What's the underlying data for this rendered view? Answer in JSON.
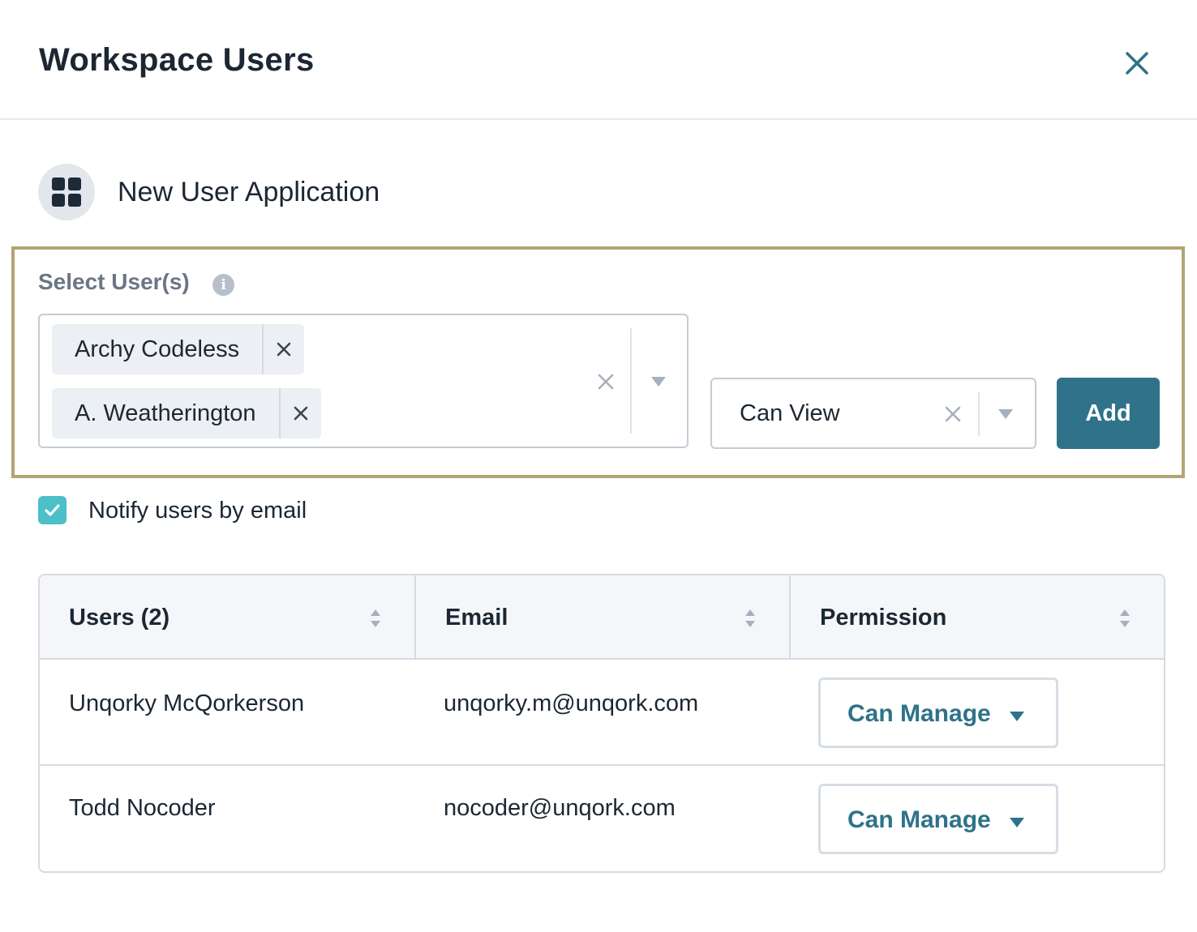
{
  "header": {
    "title": "Workspace Users"
  },
  "application": {
    "name": "New User Application",
    "icon": "grid-icon"
  },
  "select_users": {
    "label": "Select User(s)",
    "selected": [
      {
        "label": "Archy Codeless"
      },
      {
        "label": "A. Weatherington"
      }
    ],
    "permission_value": "Can View",
    "add_label": "Add"
  },
  "notify": {
    "label": "Notify users by email",
    "checked": true
  },
  "table": {
    "columns": [
      {
        "label": "Users (2)"
      },
      {
        "label": "Email"
      },
      {
        "label": "Permission"
      }
    ],
    "rows": [
      {
        "name": "Unqorky McQorkerson",
        "email": "unqorky.m@unqork.com",
        "permission": "Can Manage"
      },
      {
        "name": "Todd Nocoder",
        "email": "nocoder@unqork.com",
        "permission": "Can Manage"
      }
    ]
  },
  "colors": {
    "accent": "#2f7289",
    "checkbox": "#4dbfc8",
    "highlight_border": "#b3a573"
  }
}
